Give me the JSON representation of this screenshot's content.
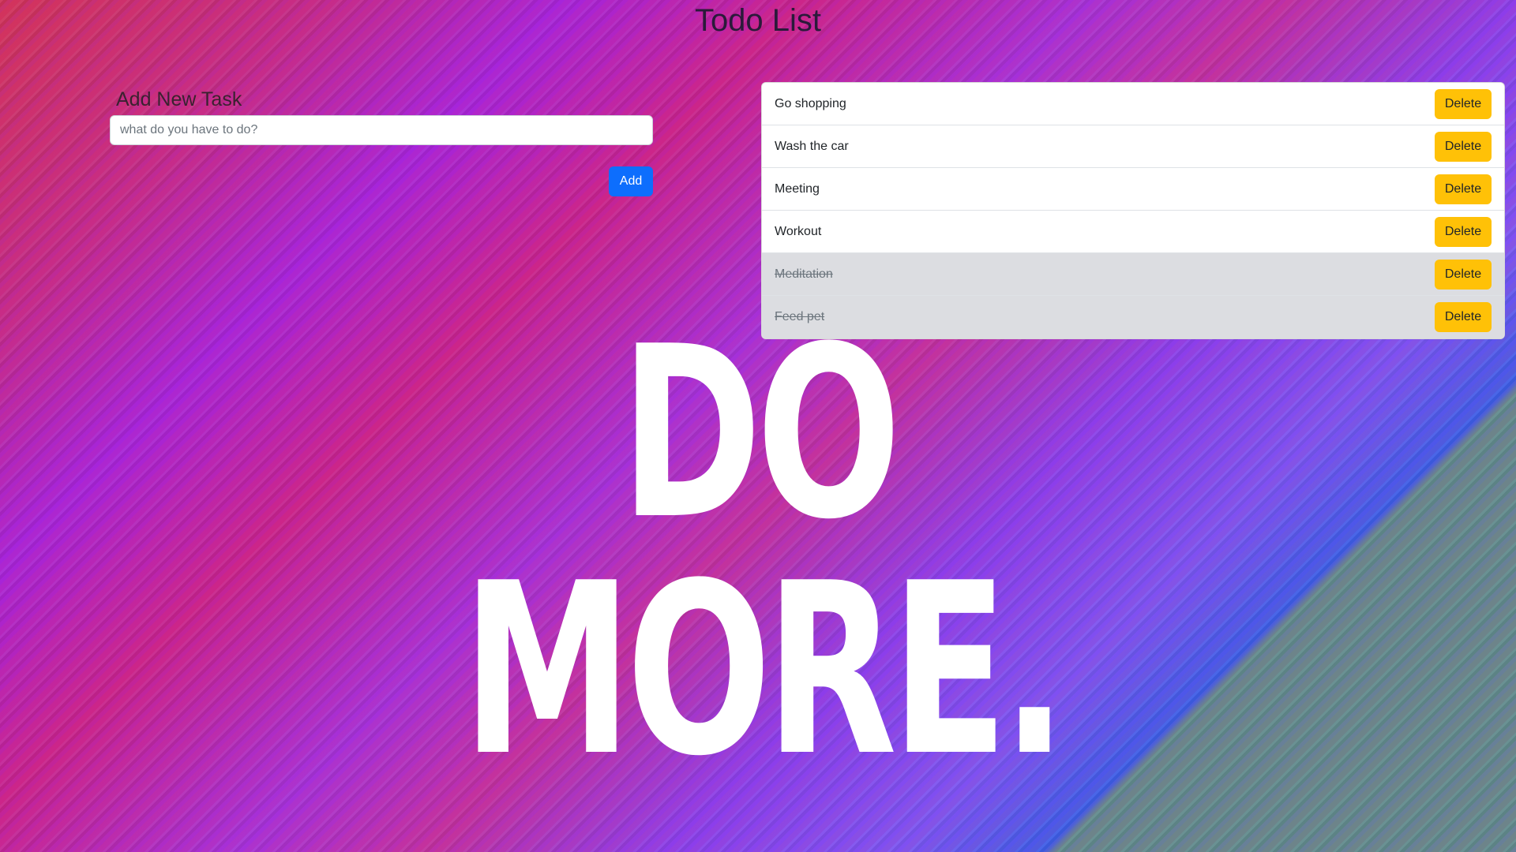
{
  "app": {
    "title": "Todo List",
    "slogan": "DO MORE."
  },
  "add_form": {
    "label": "Add New Task",
    "input_value": "",
    "input_placeholder": "what do you have to do?",
    "add_label": "Add"
  },
  "tasks": {
    "delete_label": "Delete",
    "items": [
      {
        "text": "Go shopping",
        "done": false
      },
      {
        "text": "Wash the car",
        "done": false
      },
      {
        "text": "Meeting",
        "done": false
      },
      {
        "text": "Workout",
        "done": false
      },
      {
        "text": "Meditation",
        "done": true
      },
      {
        "text": "Feed pet",
        "done": true
      }
    ]
  },
  "colors": {
    "primary": "#0d6efd",
    "warning": "#ffc107",
    "done_row": "#dcdde1"
  }
}
